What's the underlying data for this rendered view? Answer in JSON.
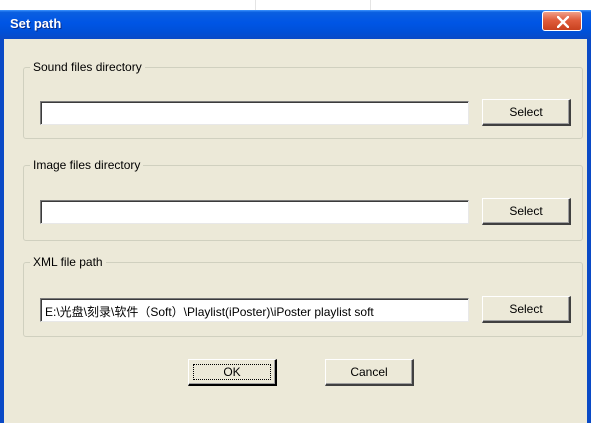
{
  "dialog": {
    "title": "Set path",
    "close_icon": "close-x-icon"
  },
  "groups": {
    "sound": {
      "label": "Sound files directory",
      "value": "",
      "select_label": "Select"
    },
    "image": {
      "label": "Image files directory",
      "value": "",
      "select_label": "Select"
    },
    "xml": {
      "label": "XML file path",
      "value": "E:\\光盘\\刻录\\软件（Soft）\\Playlist(iPoster)\\iPoster playlist soft",
      "select_label": "Select"
    }
  },
  "buttons": {
    "ok_label": "OK",
    "cancel_label": "Cancel"
  },
  "colors": {
    "titlebar": "#0055e5",
    "dialog_bg": "#ece9d8",
    "close_button": "#e05d3c"
  }
}
